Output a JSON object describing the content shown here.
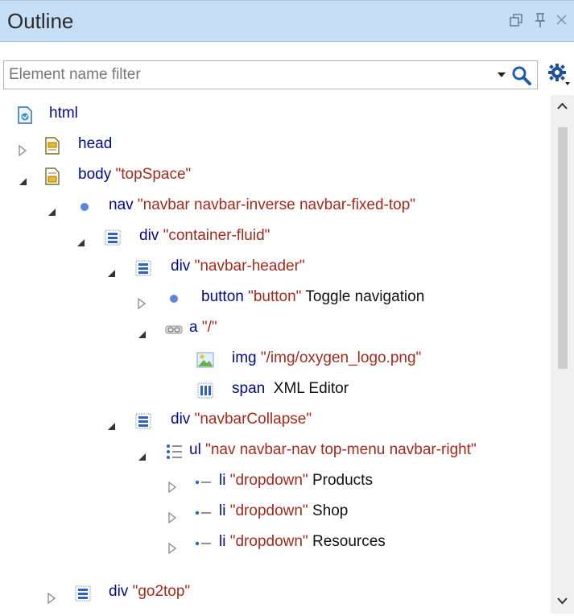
{
  "panel": {
    "title": "Outline"
  },
  "filter": {
    "placeholder": "Element name filter"
  },
  "tree": {
    "html": {
      "tag": "html"
    },
    "head": {
      "tag": "head"
    },
    "body": {
      "tag": "body",
      "attr": "\"topSpace\""
    },
    "nav": {
      "tag": "nav",
      "attr": "\"navbar navbar-inverse navbar-fixed-top\""
    },
    "div_container": {
      "tag": "div",
      "attr": "\"container-fluid\""
    },
    "div_header": {
      "tag": "div",
      "attr": "\"navbar-header\""
    },
    "button": {
      "tag": "button",
      "attr": "\"button\"",
      "text": "Toggle navigation"
    },
    "a": {
      "tag": "a",
      "attr": "\"/\""
    },
    "img": {
      "tag": "img",
      "attr": "\"/img/oxygen_logo.png\""
    },
    "span": {
      "tag": "span",
      "text": "XML Editor"
    },
    "div_collapse": {
      "tag": "div",
      "attr": "\"navbarCollapse\""
    },
    "ul": {
      "tag": "ul",
      "attr": "\"nav navbar-nav top-menu navbar-right\""
    },
    "li_products": {
      "tag": "li",
      "attr": "\"dropdown\"",
      "text": "Products"
    },
    "li_shop": {
      "tag": "li",
      "attr": "\"dropdown\"",
      "text": "Shop"
    },
    "li_resources": {
      "tag": "li",
      "attr": "\"dropdown\"",
      "text": "Resources"
    },
    "div_go2top": {
      "tag": "div",
      "attr": "\"go2top\""
    }
  }
}
